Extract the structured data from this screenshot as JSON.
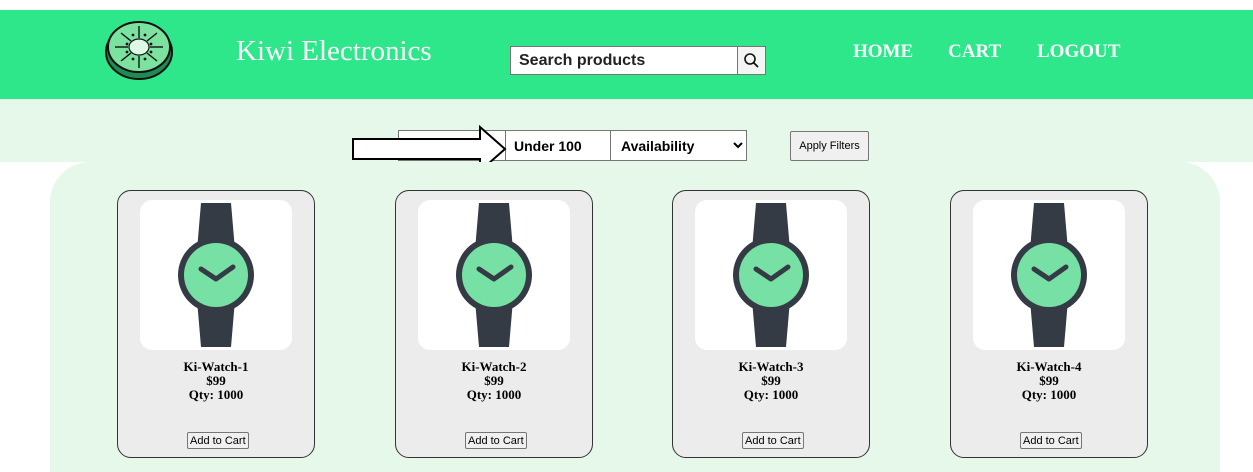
{
  "header": {
    "brand": "Kiwi Electronics",
    "search": {
      "placeholder": "Search products",
      "value": ""
    },
    "nav": [
      {
        "label": "HOME"
      },
      {
        "label": "CART"
      },
      {
        "label": "LOGOUT"
      }
    ]
  },
  "filters": {
    "price": "Under 100",
    "availability_selected": "Availability",
    "apply_label": "Apply Filters"
  },
  "products": [
    {
      "name": "Ki-Watch-1",
      "price": "$99",
      "qty": "Qty: 1000",
      "button": "Add to Cart"
    },
    {
      "name": "Ki-Watch-2",
      "price": "$99",
      "qty": "Qty: 1000",
      "button": "Add to Cart"
    },
    {
      "name": "Ki-Watch-3",
      "price": "$99",
      "qty": "Qty: 1000",
      "button": "Add to Cart"
    },
    {
      "name": "Ki-Watch-4",
      "price": "$99",
      "qty": "Qty: 1000",
      "button": "Add to Cart"
    }
  ],
  "colors": {
    "header_bg": "#2ee78a",
    "panel_bg": "#e6f8ea",
    "watch_face": "#77e0a5",
    "watch_body": "#353b44"
  }
}
